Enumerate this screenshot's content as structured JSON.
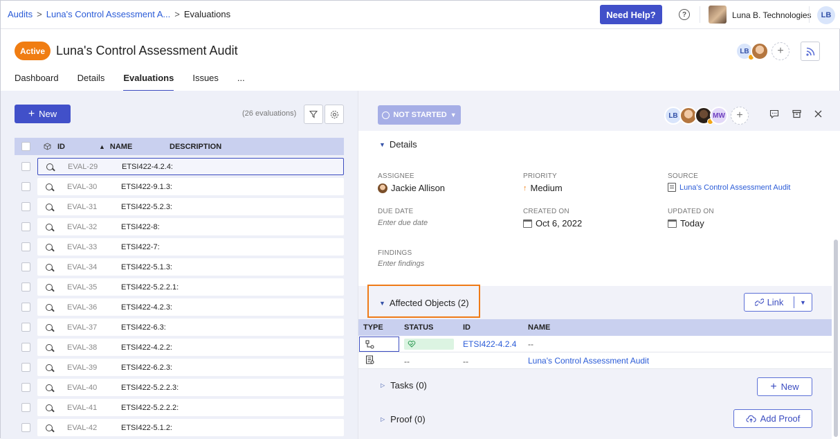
{
  "breadcrumb": {
    "root": "Audits",
    "parent": "Luna's Control Assessment A...",
    "current": "Evaluations",
    "sep": ">"
  },
  "topbar": {
    "help_label": "Need Help?",
    "org_name": "Luna B. Technologies",
    "user_initials": "LB"
  },
  "header": {
    "status_badge": "Active",
    "title": "Luna's Control Assessment Audit",
    "avatar_initials": "LB",
    "add_symbol": "+"
  },
  "tabs": [
    {
      "label": "Dashboard",
      "active": false
    },
    {
      "label": "Details",
      "active": false
    },
    {
      "label": "Evaluations",
      "active": true
    },
    {
      "label": "Issues",
      "active": false
    },
    {
      "label": "...",
      "active": false
    }
  ],
  "left": {
    "new_label": "New",
    "new_icon": "+",
    "count_text": "(26 evaluations)",
    "columns": {
      "id": "ID",
      "name": "NAME",
      "description": "DESCRIPTION"
    },
    "rows": [
      {
        "id": "EVAL-29",
        "name": "ETSI422-4.2.4:"
      },
      {
        "id": "EVAL-30",
        "name": "ETSI422-9.1.3:"
      },
      {
        "id": "EVAL-31",
        "name": "ETSI422-5.2.3:"
      },
      {
        "id": "EVAL-32",
        "name": "ETSI422-8:"
      },
      {
        "id": "EVAL-33",
        "name": "ETSI422-7:"
      },
      {
        "id": "EVAL-34",
        "name": "ETSI422-5.1.3:"
      },
      {
        "id": "EVAL-35",
        "name": "ETSI422-5.2.2.1:"
      },
      {
        "id": "EVAL-36",
        "name": "ETSI422-4.2.3:"
      },
      {
        "id": "EVAL-37",
        "name": "ETSI422-6.3:"
      },
      {
        "id": "EVAL-38",
        "name": "ETSI422-4.2.2:"
      },
      {
        "id": "EVAL-39",
        "name": "ETSI422-6.2.3:"
      },
      {
        "id": "EVAL-40",
        "name": "ETSI422-5.2.2.3:"
      },
      {
        "id": "EVAL-41",
        "name": "ETSI422-5.2.2.2:"
      },
      {
        "id": "EVAL-42",
        "name": "ETSI422-5.1.2:"
      }
    ]
  },
  "right": {
    "status_label": "NOT STARTED",
    "avatar_lb": "LB",
    "avatar_mw": "MW",
    "details_heading": "Details",
    "assignee_label": "ASSIGNEE",
    "assignee_value": "Jackie Allison",
    "priority_label": "PRIORITY",
    "priority_value": "Medium",
    "priority_arrow": "↑",
    "source_label": "SOURCE",
    "source_value": "Luna's Control Assessment Audit",
    "due_label": "DUE DATE",
    "due_placeholder": "Enter due date",
    "created_label": "CREATED ON",
    "created_value": "Oct 6, 2022",
    "updated_label": "UPDATED ON",
    "updated_value": "Today",
    "findings_label": "FINDINGS",
    "findings_placeholder": "Enter findings",
    "affected_heading": "Affected Objects (2)",
    "link_label": "Link",
    "aff_columns": {
      "type": "TYPE",
      "status": "STATUS",
      "id": "ID",
      "name": "NAME"
    },
    "aff_rows": [
      {
        "id": "ETSI422-4.2.4",
        "name": "--",
        "status": ""
      },
      {
        "id": "--",
        "name": "Luna's Control Assessment Audit",
        "status": "--"
      }
    ],
    "tasks_heading": "Tasks (0)",
    "tasks_button": "New",
    "proof_heading": "Proof (0)",
    "proof_button": "Add Proof"
  },
  "colors": {
    "accent": "#4150c9",
    "active_badge": "#f07d12",
    "highlight_box": "#ef7a16",
    "link": "#2a5bd7"
  }
}
